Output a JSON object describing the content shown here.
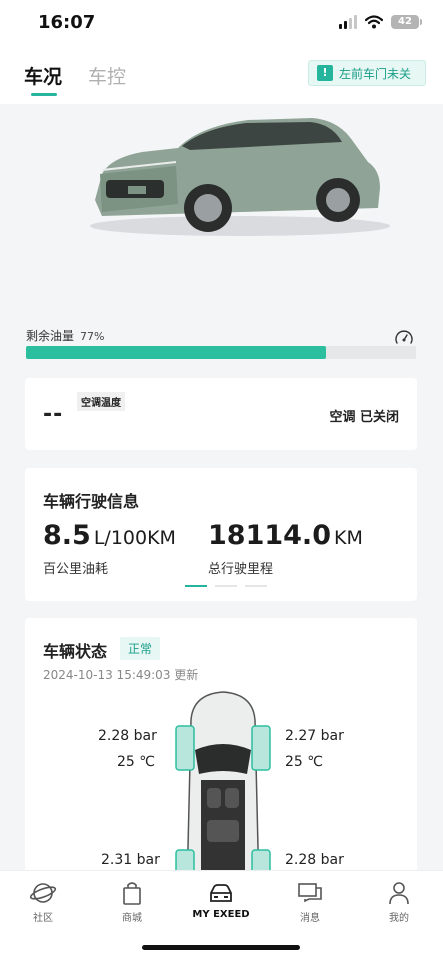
{
  "status_bar": {
    "time": "16:07",
    "battery": "42"
  },
  "tabs": {
    "active": "车况",
    "inactive": "车控"
  },
  "alert": {
    "icon": "!",
    "text": "左前车门未关"
  },
  "fuel": {
    "label": "剩余油量",
    "percent_text": "77%",
    "fraction": 0.77
  },
  "ac": {
    "value": "--",
    "temp_label": "空调温度",
    "status": "空调 已关闭"
  },
  "drive_info": {
    "title": "车辆行驶信息",
    "fuel_consumption": {
      "value": "8.5",
      "unit": "L/100KM",
      "caption": "百公里油耗"
    },
    "total_mileage": {
      "value": "18114.0",
      "unit": "KM",
      "caption": "总行驶里程"
    }
  },
  "vehicle_status": {
    "title": "车辆状态",
    "badge": "正常",
    "updated": "2024-10-13 15:49:03 更新",
    "tires": {
      "front_left": {
        "pressure": "2.28 bar",
        "temp": "25 ℃"
      },
      "front_right": {
        "pressure": "2.27 bar",
        "temp": "25 ℃"
      },
      "rear_left": {
        "pressure": "2.31 bar"
      },
      "rear_right": {
        "pressure": "2.28 bar"
      }
    }
  },
  "nav": [
    {
      "label": "社区",
      "icon": "planet-icon"
    },
    {
      "label": "商城",
      "icon": "shopping-bag-icon"
    },
    {
      "label": "MY EXEED",
      "icon": "car-front-icon",
      "active": true
    },
    {
      "label": "消息",
      "icon": "chat-icon"
    },
    {
      "label": "我的",
      "icon": "person-icon"
    }
  ],
  "colors": {
    "accent": "#24b59c",
    "fuel_bar": "#2bbf9f",
    "background": "#f4f5f7"
  }
}
